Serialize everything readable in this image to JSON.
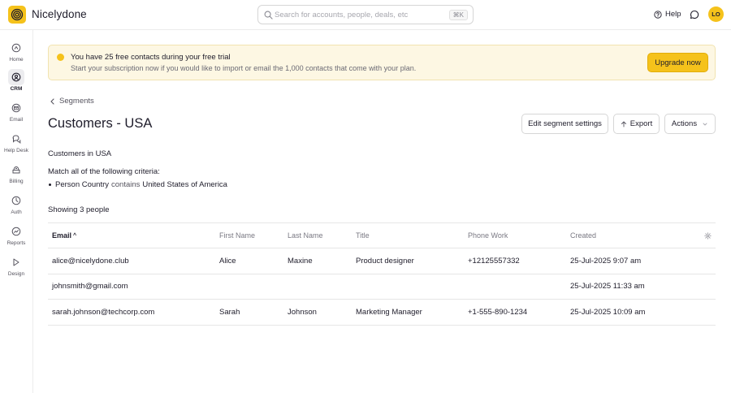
{
  "app": {
    "title": "Nicelydone",
    "avatar_initials": "LO"
  },
  "search": {
    "placeholder": "Search for accounts, people, deals, etc",
    "shortcut": "⌘K"
  },
  "topbar": {
    "help_label": "Help"
  },
  "sidebar": {
    "items": [
      {
        "label": "Home",
        "icon": "home-icon"
      },
      {
        "label": "CRM",
        "icon": "crm-icon",
        "active": true
      },
      {
        "label": "Email",
        "icon": "email-icon"
      },
      {
        "label": "Help Desk",
        "icon": "help-desk-icon"
      },
      {
        "label": "Billing",
        "icon": "billing-icon"
      },
      {
        "label": "Auth",
        "icon": "auth-icon"
      },
      {
        "label": "Reports",
        "icon": "reports-icon"
      },
      {
        "label": "Design",
        "icon": "design-icon"
      }
    ]
  },
  "banner": {
    "title": "You have 25 free contacts during your free trial",
    "subtitle": "Start your subscription now if you would like to import or email the 1,000 contacts that come with your plan.",
    "cta": "Upgrade now",
    "accent_color": "#f5c21b"
  },
  "breadcrumb": {
    "label": "Segments"
  },
  "page": {
    "title": "Customers - USA"
  },
  "buttons": {
    "edit": "Edit segment settings",
    "export": "Export",
    "actions": "Actions"
  },
  "segment": {
    "description": "Customers in USA",
    "criteria_label": "Match all of the following criteria:",
    "criteria": {
      "field": "Person Country",
      "operator": "contains",
      "value": "United States of America"
    },
    "showing": "Showing 3 people"
  },
  "table": {
    "columns": {
      "email": "Email",
      "first_name": "First Name",
      "last_name": "Last Name",
      "title": "Title",
      "phone": "Phone Work",
      "created": "Created"
    },
    "sort_indicator": "^",
    "rows": [
      {
        "email": "alice@nicelydone.club",
        "first_name": "Alice",
        "last_name": "Maxine",
        "title": "Product designer",
        "phone": "+12125557332",
        "created": "25-Jul-2025 9:07 am"
      },
      {
        "email": "johnsmith@gmail.com",
        "first_name": "",
        "last_name": "",
        "title": "",
        "phone": "",
        "created": "25-Jul-2025 11:33 am"
      },
      {
        "email": "sarah.johnson@techcorp.com",
        "first_name": "Sarah",
        "last_name": "Johnson",
        "title": "Marketing Manager",
        "phone": "+1-555-890-1234",
        "created": "25-Jul-2025 10:09 am"
      }
    ]
  }
}
